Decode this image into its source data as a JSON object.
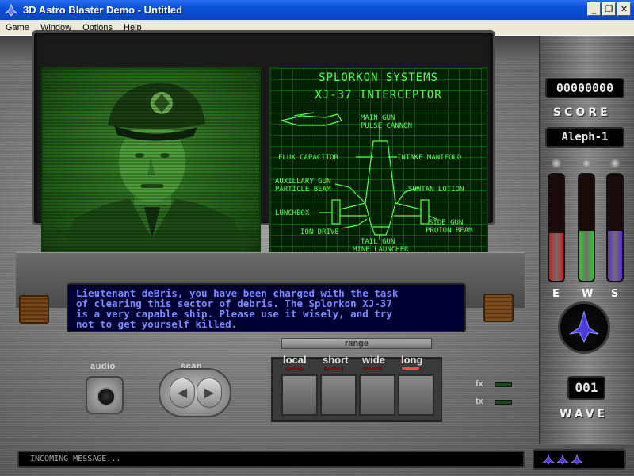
{
  "window": {
    "title": "3D Astro Blaster Demo - Untitled",
    "buttons": {
      "minimize": "_",
      "maximize": "❐",
      "close": "✕"
    }
  },
  "menu": [
    "Game",
    "Window",
    "Options",
    "Help"
  ],
  "blueprint": {
    "title1": "SPLORKON SYSTEMS",
    "title2": "XJ-37 INTERCEPTOR",
    "labels": {
      "main_gun": "MAIN GUN",
      "pulse_cannon": "PULSE CANNON",
      "flux_capacitor": "FLUX CAPACITOR",
      "intake_manifold": "INTAKE MANIFOLD",
      "auxiliary_gun": "AUXILLARY GUN",
      "particle_beam": "PARTICLE BEAM",
      "suntan_lotion": "SUNTAN LOTION",
      "lunchbox": "LUNCHBOX",
      "side_gun": "SIDE GUN",
      "proton_beam": "PROTON BEAM",
      "ion_drive": "ION DRIVE",
      "tail_gun": "TAIL GUN",
      "mine_launcher": "MINE LAUNCHER"
    }
  },
  "message": {
    "line1": "Lieutenant deBris, you have been charged with the task",
    "line2": "of clearing this sector of debris.  The Splorkon XJ-37",
    "line3": "is a very capable ship.  Please use it wisely, and try",
    "line4": "not to get yourself killed."
  },
  "controls": {
    "audio_label": "audio",
    "scan_label": "scan",
    "scan_left": "◀",
    "scan_right": "▶",
    "range_title": "range",
    "range_options": [
      "local",
      "short",
      "wide",
      "long"
    ],
    "range_selected": "long",
    "fx_label": "fx",
    "tx_label": "tx"
  },
  "hud": {
    "score_value": "00000000",
    "score_label": "SCORE",
    "pilot_name": "Aleph-1",
    "gauges": [
      {
        "letter": "E",
        "level": 0.45,
        "color": "#c81e1e"
      },
      {
        "letter": "W",
        "level": 0.47,
        "color": "#2ec82e"
      },
      {
        "letter": "S",
        "level": 0.47,
        "color": "#5a2ed8"
      }
    ],
    "wave_value": "001",
    "wave_label": "WAVE",
    "lives": 3
  },
  "status": {
    "text": "INCOMING MESSAGE..."
  },
  "colors": {
    "titlebar": "#0a50d8",
    "crt_green": "#55ff55",
    "message_text": "#7a8bff",
    "message_bg": "#000033",
    "ship_purple": "#5a2ed8"
  }
}
